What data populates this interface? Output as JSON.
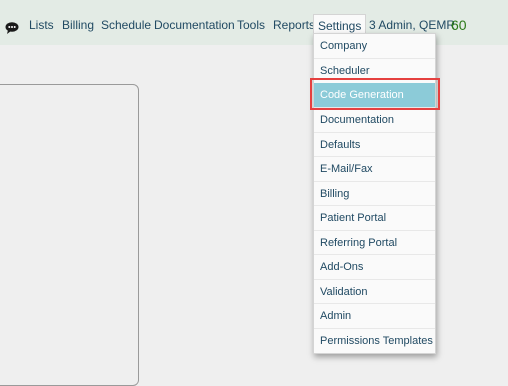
{
  "navbar": {
    "chat_icon": "chat-bubble-icon",
    "items": [
      {
        "label": "Lists"
      },
      {
        "label": "Billing"
      },
      {
        "label": "Schedule"
      },
      {
        "label": "Documentation"
      },
      {
        "label": "Tools"
      },
      {
        "label": "Reports"
      },
      {
        "label": "Settings",
        "active": true
      }
    ],
    "user": "3 Admin, QEMR",
    "count": "60"
  },
  "settings_menu": {
    "selected": "Code Generation",
    "items": [
      {
        "label": "Company"
      },
      {
        "label": "Scheduler"
      },
      {
        "label": "Code Generation"
      },
      {
        "label": "Documentation"
      },
      {
        "label": "Defaults"
      },
      {
        "label": "E-Mail/Fax"
      },
      {
        "label": "Billing"
      },
      {
        "label": "Patient Portal"
      },
      {
        "label": "Referring Portal"
      },
      {
        "label": "Add-Ons"
      },
      {
        "label": "Validation"
      },
      {
        "label": "Admin"
      },
      {
        "label": "Permissions Templates"
      }
    ]
  },
  "colors": {
    "navbar_bg": "#e3ebe5",
    "link": "#214a63",
    "count": "#2c7a18",
    "selected_bg": "#8ccbd8",
    "annotation": "#e5403f"
  }
}
